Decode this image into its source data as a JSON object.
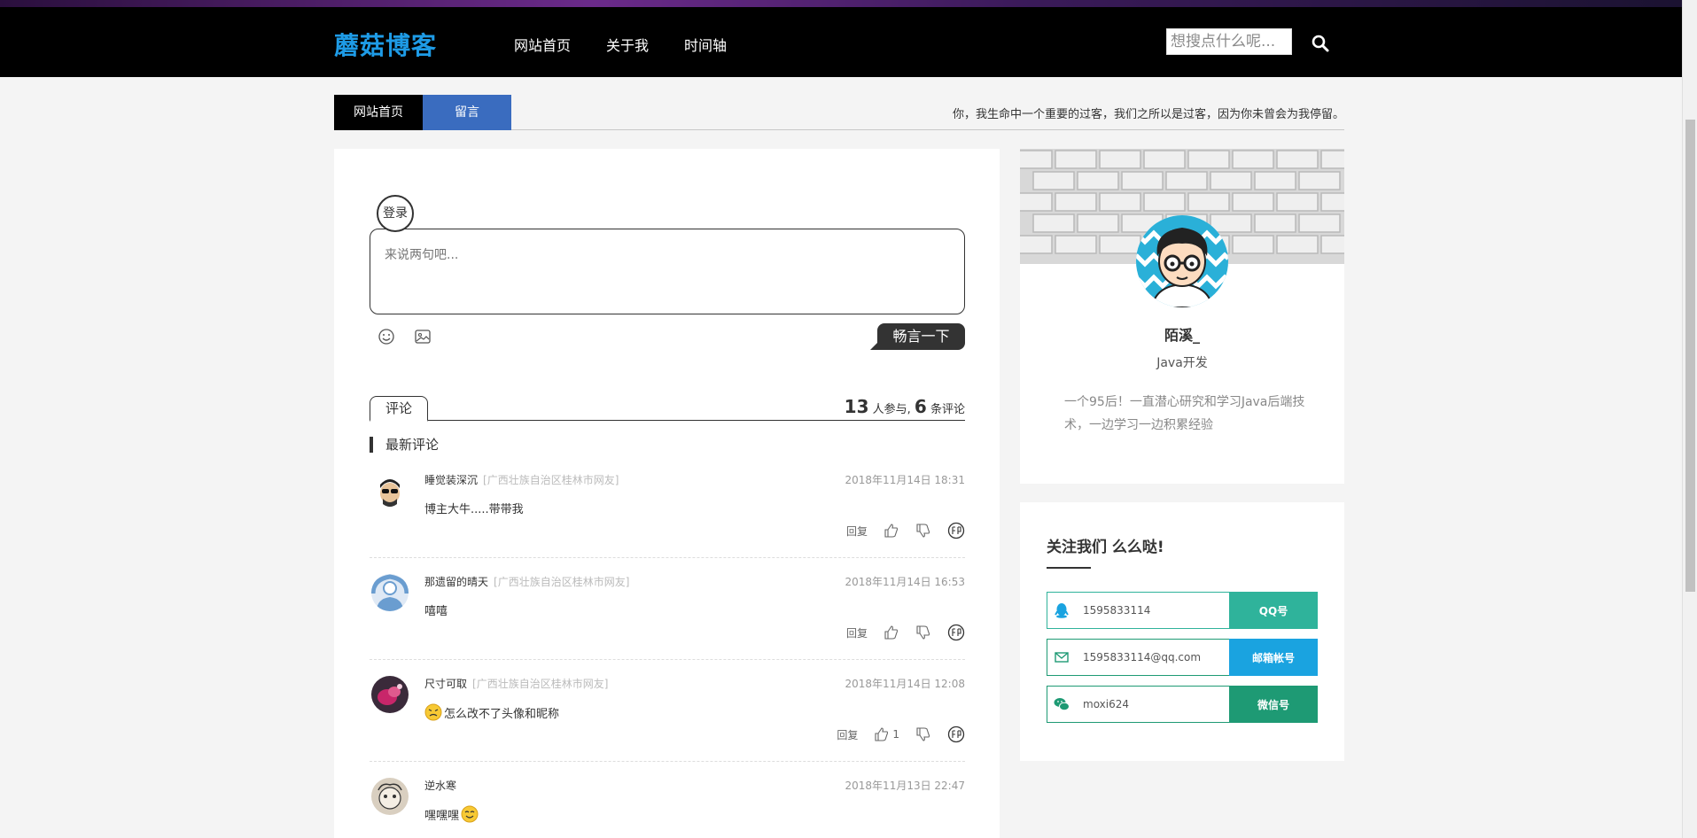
{
  "header": {
    "logo": "蘑菇博客",
    "nav": [
      "网站首页",
      "关于我",
      "时间轴"
    ],
    "search_placeholder": "想搜点什么呢..."
  },
  "tabbar": {
    "tabs": [
      "网站首页",
      "留言"
    ],
    "motto": "你，我生命中一个重要的过客，我们之所以是过客，因为你未曾会为我停留。"
  },
  "composer": {
    "login_label": "登录",
    "placeholder": "来说两句吧...",
    "send_label": "畅言一下"
  },
  "comments_section": {
    "tab_label": "评论",
    "participants": "13",
    "participants_label": "人参与,",
    "comment_count": "6",
    "comment_count_label": "条评论",
    "newest_label": "最新评论",
    "reply_label": "回复",
    "items": [
      {
        "name": "睡觉装深沉",
        "location": "[广西壮族自治区桂林市网友]",
        "time": "2018年11月14日 18:31",
        "text": "博主大牛.....带带我",
        "likes": ""
      },
      {
        "name": "那遗留的晴天",
        "location": "[广西壮族自治区桂林市网友]",
        "time": "2018年11月14日 16:53",
        "text": "嘻嘻",
        "likes": ""
      },
      {
        "name": "尺寸可取",
        "location": "[广西壮族自治区桂林市网友]",
        "time": "2018年11月14日 12:08",
        "text": "怎么改不了头像和昵称",
        "likes": "1"
      },
      {
        "name": "逆水寒",
        "location": "",
        "time": "2018年11月13日 22:47",
        "text": "嘿嘿嘿",
        "likes": ""
      }
    ]
  },
  "profile": {
    "name": "陌溪_",
    "role": "Java开发",
    "bio": "一个95后！一直潜心研究和学习Java后端技术，一边学习一边积累经验"
  },
  "follow": {
    "title": "关注我们 么么哒!",
    "rows": [
      {
        "icon": "qq-icon",
        "value": "1595833114",
        "button": "QQ号",
        "color": "#2fb39b"
      },
      {
        "icon": "mail-icon",
        "value": "1595833114@qq.com",
        "button": "邮箱帐号",
        "color": "#1aa3e0"
      },
      {
        "icon": "wechat-icon",
        "value": "moxi624",
        "button": "微信号",
        "color": "#1e9a74"
      }
    ]
  },
  "colors": {
    "logo": "#1e9be6",
    "tab_message": "#3a6cbf",
    "nav_bg": "#000000"
  }
}
